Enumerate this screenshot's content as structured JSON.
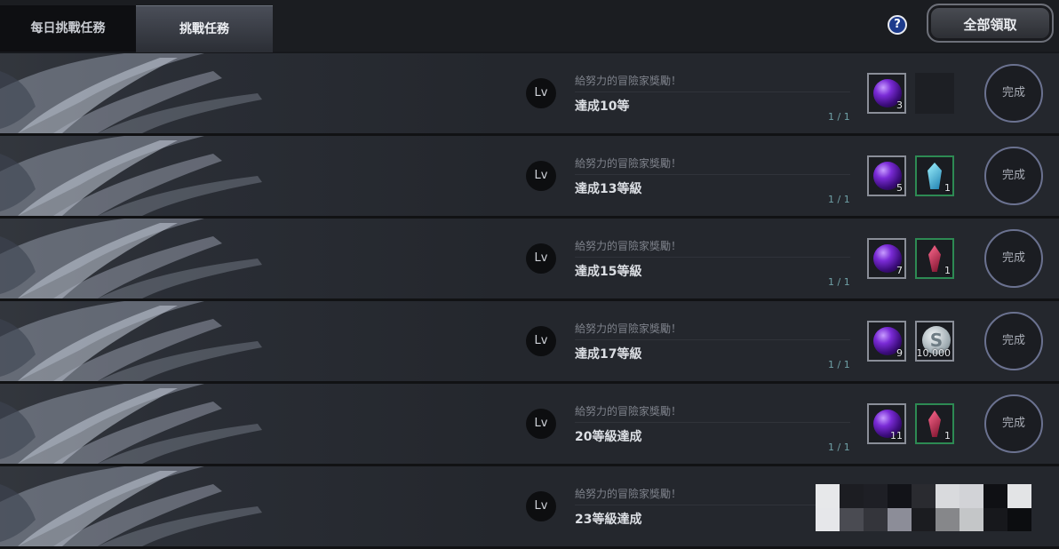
{
  "tabs": [
    {
      "label": "每日挑戰任務",
      "active": false
    },
    {
      "label": "挑戰任務",
      "active": true
    }
  ],
  "help_label": "?",
  "claim_all_label": "全部領取",
  "level_badge": "Lv",
  "complete_label": "完成",
  "quests": [
    {
      "subtitle": "給努力的冒險家獎勵！",
      "title": "達成10等",
      "progress": "1 / 1",
      "rewards": [
        {
          "icon": "purple-orb-icon",
          "count": "3"
        },
        {
          "icon": "empty-slot",
          "count": ""
        }
      ]
    },
    {
      "subtitle": "給努力的冒險家獎勵！",
      "title": "達成13等級",
      "progress": "1 / 1",
      "rewards": [
        {
          "icon": "purple-orb-icon",
          "count": "5"
        },
        {
          "icon": "blue-crystal-icon",
          "count": "1"
        }
      ]
    },
    {
      "subtitle": "給努力的冒險家獎勵！",
      "title": "達成15等級",
      "progress": "1 / 1",
      "rewards": [
        {
          "icon": "purple-orb-icon",
          "count": "7"
        },
        {
          "icon": "red-crystal-icon",
          "count": "1"
        }
      ]
    },
    {
      "subtitle": "給努力的冒險家獎勵！",
      "title": "達成17等級",
      "progress": "1 / 1",
      "rewards": [
        {
          "icon": "purple-orb-icon",
          "count": "9"
        },
        {
          "icon": "silver-coin-icon",
          "count": "10,000"
        }
      ]
    },
    {
      "subtitle": "給努力的冒險家獎勵！",
      "title": "20等級達成",
      "progress": "1 / 1",
      "rewards": [
        {
          "icon": "purple-orb-icon",
          "count": "11"
        },
        {
          "icon": "red-crystal-icon",
          "count": "1"
        }
      ]
    },
    {
      "subtitle": "給努力的冒險家獎勵！",
      "title": "23等級達成",
      "progress": "",
      "rewards": []
    }
  ]
}
